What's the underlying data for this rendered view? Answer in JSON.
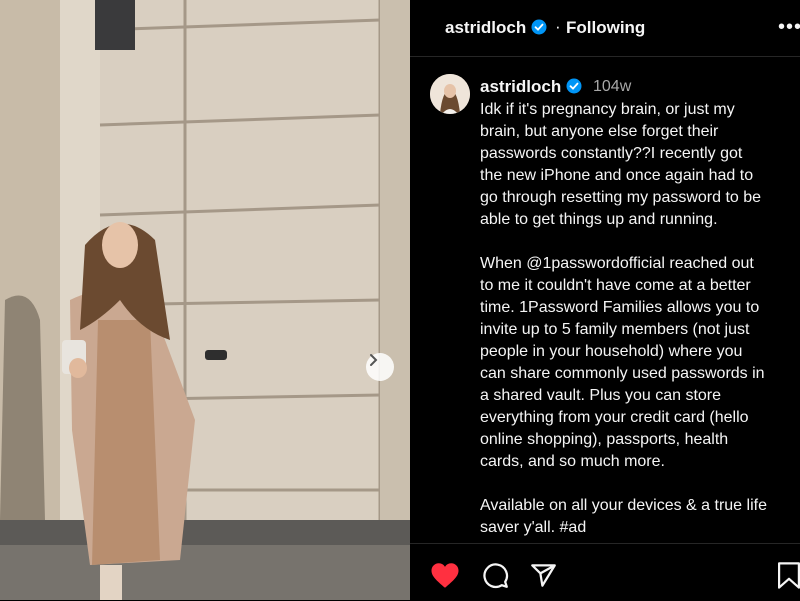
{
  "post": {
    "header": {
      "username": "astridloch",
      "separator": "·",
      "follow_status": "Following",
      "more_label": "•••"
    },
    "caption": {
      "username": "astridloch",
      "timestamp": "104w",
      "lines": [
        "Idk if it's pregnancy brain, or just my",
        "brain, but anyone else forget their",
        "passwords constantly??I recently got",
        "the new iPhone and once again had to",
        "go through resetting my password to be",
        "able to get things up and running.",
        "",
        "When @1passwordofficial reached out",
        "to me it couldn't have come at a better",
        "time. 1Password Families allows you to",
        "invite up to 5 family members (not just",
        "people in your household) where you",
        "can share commonly used passwords in",
        "a shared vault. Plus you can store",
        "everything from your credit card (hello",
        "online shopping), passports, health",
        "cards, and so much more.",
        "",
        "Available on all your devices & a true life",
        "saver y'all. #ad"
      ]
    },
    "actions": {
      "like_icon": "heart-icon",
      "comment_icon": "comment-icon",
      "share_icon": "share-icon",
      "save_icon": "bookmark-icon",
      "like_color": "#ff3040"
    },
    "carousel": {
      "next_icon": "chevron-right-icon"
    }
  }
}
